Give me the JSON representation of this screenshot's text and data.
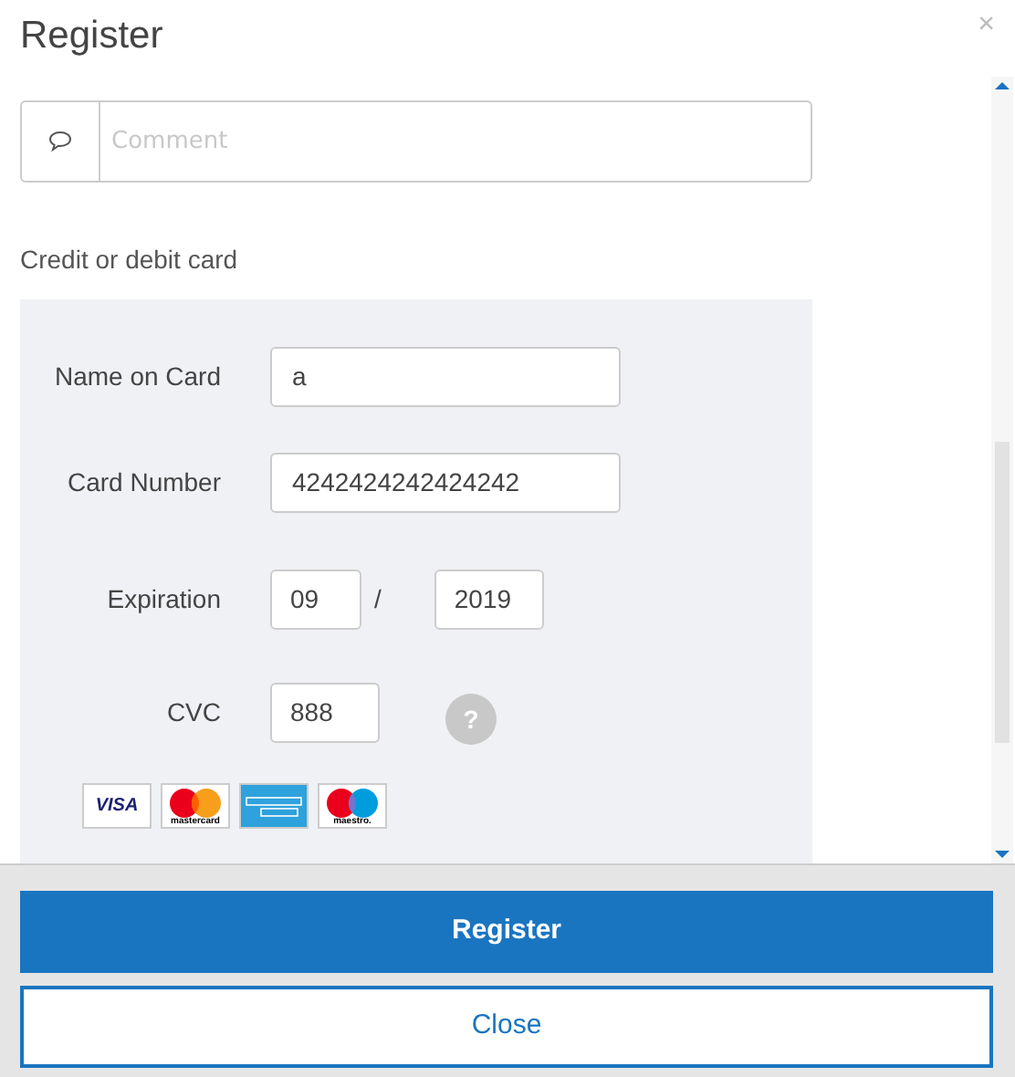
{
  "dialog": {
    "title": "Register",
    "close": "×"
  },
  "comment": {
    "placeholder": "Comment"
  },
  "section_title": "Credit or debit card",
  "card_form": {
    "name": {
      "label": "Name on Card",
      "value": "a"
    },
    "number": {
      "label": "Card Number",
      "value": "4242424242424242"
    },
    "expiration": {
      "label": "Expiration",
      "month": "09",
      "separator": "/",
      "year": "2019"
    },
    "cvc": {
      "label": "CVC",
      "value": "888",
      "help": "?"
    }
  },
  "card_logos": [
    {
      "kind": "visa",
      "label": "VISA"
    },
    {
      "kind": "mastercard",
      "label": "mastercard"
    },
    {
      "kind": "amex"
    },
    {
      "kind": "maestro",
      "label": "maestro."
    }
  ],
  "buttons": [
    {
      "kind": "primary",
      "label": "Register"
    },
    {
      "kind": "secondary",
      "label": "Close"
    }
  ]
}
